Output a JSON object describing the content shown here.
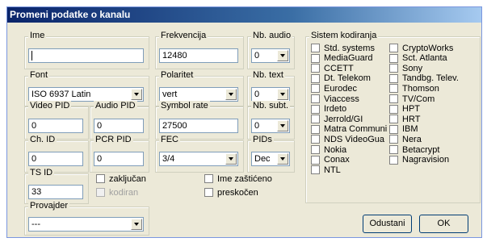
{
  "window": {
    "title": "Promeni podatke o kanalu"
  },
  "fields": {
    "ime": {
      "label": "Ime",
      "value": ""
    },
    "frekvencija": {
      "label": "Frekvencija",
      "value": "12480"
    },
    "nb_audio": {
      "label": "Nb. audio",
      "value": "0"
    },
    "font": {
      "label": "Font",
      "value": "ISO 6937 Latin"
    },
    "polaritet": {
      "label": "Polaritet",
      "value": "vert"
    },
    "nb_text": {
      "label": "Nb. text",
      "value": "0"
    },
    "video_pid": {
      "label": "Video PID",
      "value": "0"
    },
    "audio_pid": {
      "label": "Audio PID",
      "value": "0"
    },
    "symbol_rate": {
      "label": "Symbol rate",
      "value": "27500"
    },
    "nb_subt": {
      "label": "Nb. subt.",
      "value": "0"
    },
    "ch_id": {
      "label": "Ch. ID",
      "value": "0"
    },
    "pcr_pid": {
      "label": "PCR PID",
      "value": "0"
    },
    "fec": {
      "label": "FEC",
      "value": "3/4"
    },
    "pids": {
      "label": "PIDs",
      "value": "Dec"
    },
    "ts_id": {
      "label": "TS ID",
      "value": "33"
    },
    "provajder": {
      "label": "Provajder",
      "value": "---"
    }
  },
  "flags": {
    "zakljucan": "zaključan",
    "kodiran": "kodiran",
    "ime_zasticeno": "Ime zaštićeno",
    "preskocen": "preskočen"
  },
  "encryption": {
    "label": "Sistem kodiranja",
    "left": [
      "Std. systems",
      "MediaGuard",
      "CCETT",
      "Dt. Telekom",
      "Eurodec",
      "Viaccess",
      "Irdeto",
      "Jerrold/GI",
      "Matra Communi",
      "NDS VideoGua",
      "Nokia",
      "Conax",
      "NTL"
    ],
    "right": [
      "CryptoWorks",
      "Sct. Atlanta",
      "Sony",
      "Tandbg. Telev.",
      "Thomson",
      "TV/Com",
      "HPT",
      "HRT",
      "IBM",
      "Nera",
      "Betacrypt",
      "Nagravision"
    ]
  },
  "buttons": {
    "cancel": "Odustani",
    "ok": "OK"
  }
}
